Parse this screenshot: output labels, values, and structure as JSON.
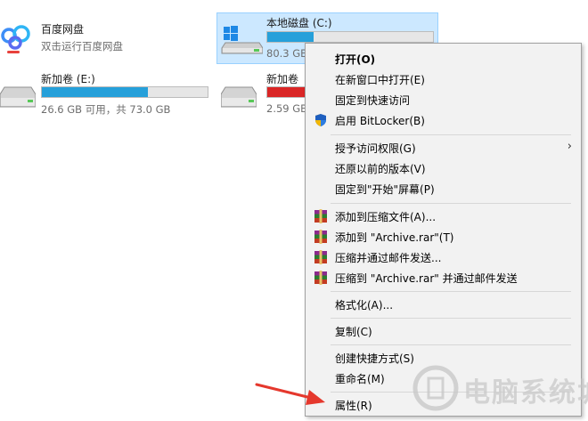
{
  "drives": [
    {
      "name": "百度网盘",
      "sub": "双击运行百度网盘"
    },
    {
      "name": "本地磁盘 (C:)",
      "sub": "80.3 GB",
      "used": 0.28,
      "color": "#26a0da"
    },
    {
      "name": "新加卷 (E:)",
      "sub": "26.6 GB 可用，共 73.0 GB",
      "used": 0.64,
      "color": "#26a0da"
    },
    {
      "name": "新加卷",
      "sub": "2.59 GB",
      "used": 0.9,
      "color": "#da2626"
    }
  ],
  "menu": {
    "items": [
      {
        "label": "打开(O)",
        "bold": true
      },
      {
        "label": "在新窗口中打开(E)"
      },
      {
        "label": "固定到快速访问"
      },
      {
        "label": "启用 BitLocker(B)",
        "icon": "shield-icon"
      },
      {
        "label": "授予访问权限(G)",
        "submenu": "›"
      },
      {
        "label": "还原以前的版本(V)"
      },
      {
        "label": "固定到\"开始\"屏幕(P)"
      },
      {
        "label": "添加到压缩文件(A)...",
        "icon": "winrar-icon"
      },
      {
        "label": "添加到 \"Archive.rar\"(T)",
        "icon": "winrar-icon"
      },
      {
        "label": "压缩并通过邮件发送...",
        "icon": "winrar-icon"
      },
      {
        "label": "压缩到 \"Archive.rar\" 并通过邮件发送",
        "icon": "winrar-icon"
      },
      {
        "label": "格式化(A)..."
      },
      {
        "label": "复制(C)"
      },
      {
        "label": "创建快捷方式(S)"
      },
      {
        "label": "重命名(M)"
      },
      {
        "label": "属性(R)"
      }
    ]
  },
  "watermark": {
    "text": "电脑系统城"
  },
  "colors": {
    "accent": "#26a0da",
    "danger": "#da2626",
    "selection": "#cce8ff",
    "arrow": "#e5382d"
  }
}
